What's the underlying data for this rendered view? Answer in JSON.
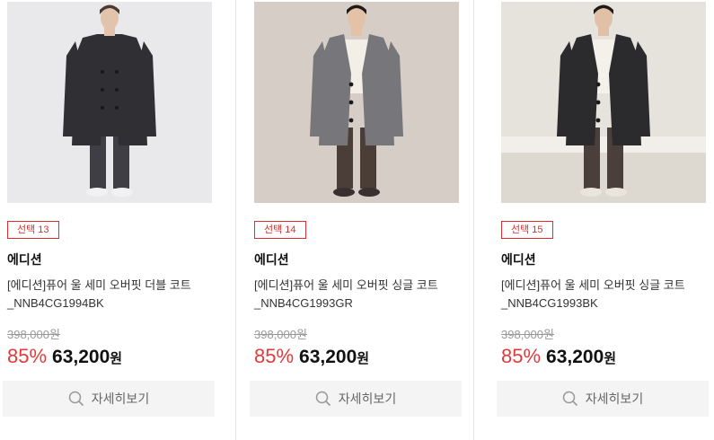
{
  "products": [
    {
      "badge": "선택 13",
      "brand": "에디션",
      "title_line1": "[에디션]퓨어 울 세미 오버핏 더블 코트",
      "title_line2": "_NNB4CG1994BK",
      "original_price": "398,000원",
      "discount": "85%",
      "price": "63,200",
      "currency": "원",
      "detail_label": "자세히보기",
      "image": {
        "bg": "#e9e9eb",
        "coat": "#2f2f34",
        "inner": "#3a3a3e",
        "pants": "#3e3e44",
        "shoes": "#f1f1f1",
        "skin": "#e2c4ad",
        "hair": "#4a3a30",
        "style": "double"
      }
    },
    {
      "badge": "선택 14",
      "brand": "에디션",
      "title_line1": "[에디션]퓨어 울 세미 오버핏 싱글 코트",
      "title_line2": "_NNB4CG1993GR",
      "original_price": "398,000원",
      "discount": "85%",
      "price": "63,200",
      "currency": "원",
      "detail_label": "자세히보기",
      "image": {
        "bg": "#d5cdc6",
        "coat": "#77777b",
        "inner": "#f3efe6",
        "pants": "#4b3e37",
        "shoes": "#3a3030",
        "skin": "#e3c2a8",
        "hair": "#1f1a18",
        "style": "single"
      }
    },
    {
      "badge": "선택 15",
      "brand": "에디션",
      "title_line1": "[에디션]퓨어 울 세미 오버핏 싱글 코트",
      "title_line2": "_NNB4CG1993BK",
      "original_price": "398,000원",
      "discount": "85%",
      "price": "63,200",
      "currency": "원",
      "detail_label": "자세히보기",
      "image": {
        "bg": "#e6e2dc",
        "coat": "#2b2b2e",
        "inner": "#f4f1ea",
        "pants": "#4a3f3a",
        "shoes": "#e9e4dc",
        "skin": "#e0c0a6",
        "hair": "#1e1a18",
        "style": "single-dark"
      }
    }
  ]
}
